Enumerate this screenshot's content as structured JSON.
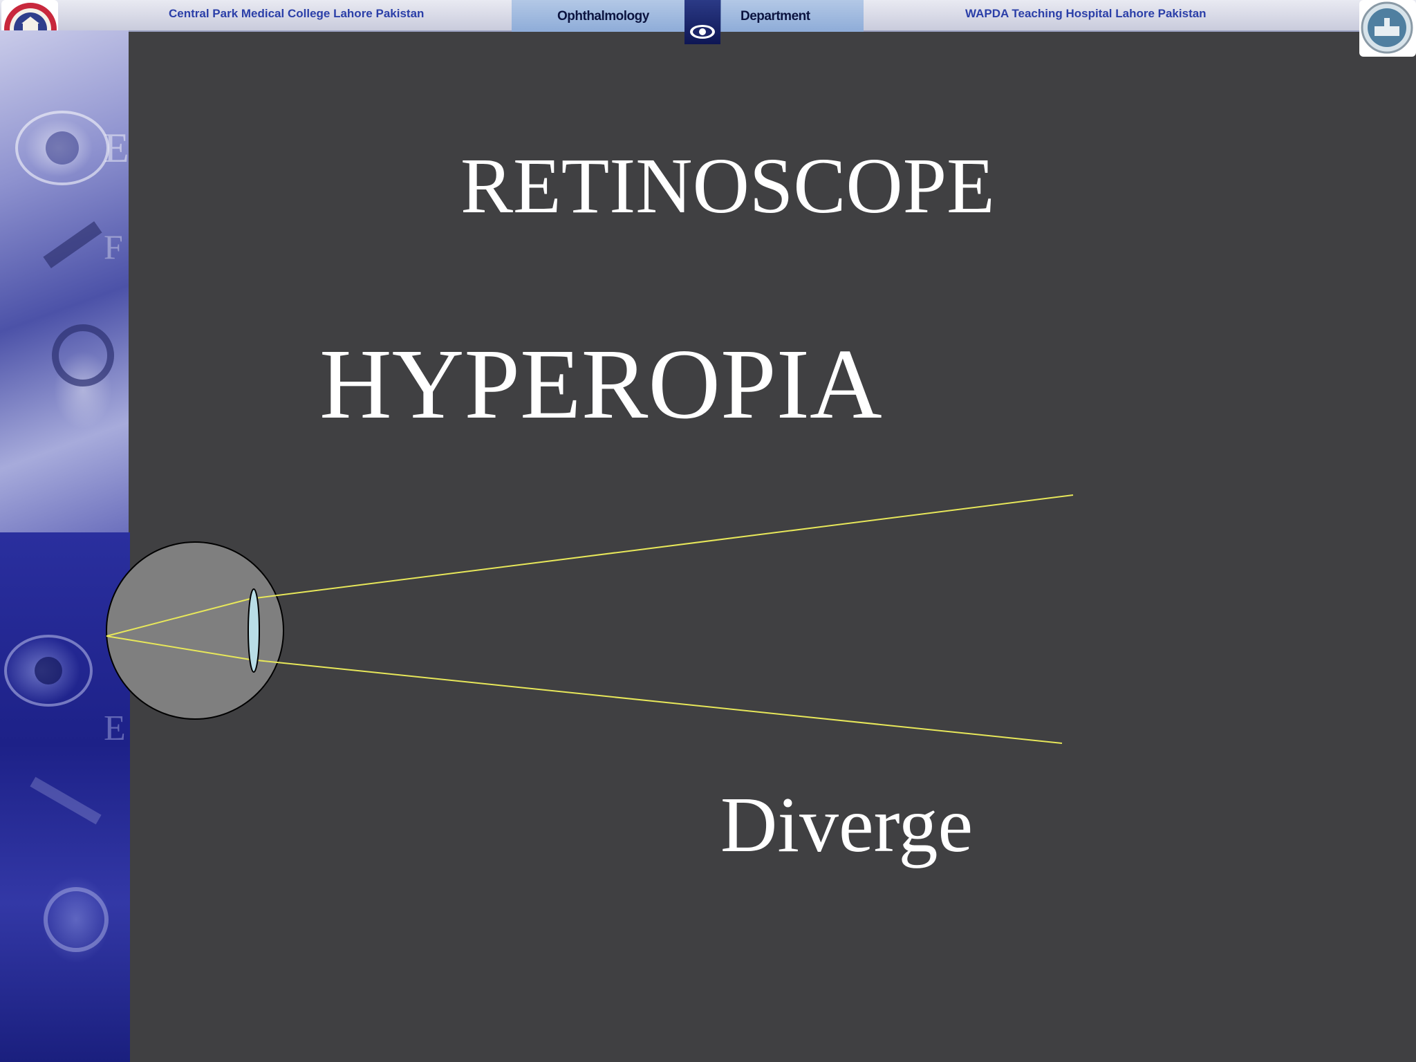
{
  "header": {
    "college": "Central Park Medical College Lahore  Pakistan",
    "department_left": "Ophthalmology",
    "department_right": "Department",
    "hospital": "WAPDA Teaching Hospital  Lahore Pakistan"
  },
  "slide": {
    "title": "RETINOSCOPE",
    "heading": "HYPEROPIA",
    "ray_label": "Diverge"
  },
  "colors": {
    "background": "#404042",
    "text": "#ffffff",
    "rays": "#e8e85a",
    "eyeball": "#7f7f7f",
    "lens": "#b9dde6"
  }
}
